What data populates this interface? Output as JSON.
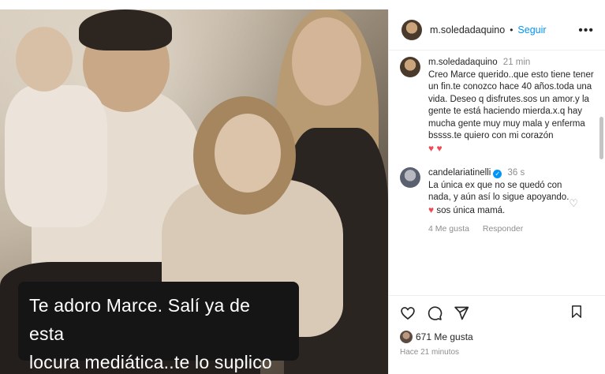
{
  "post": {
    "caption_line1": "Te adoro Marce. Salí ya de  esta",
    "caption_line2": "locura mediática..te lo suplico"
  },
  "header": {
    "username": "m.soledadaquino",
    "separator": "•",
    "follow_label": "Seguir",
    "more_icon": "more-horizontal-icon"
  },
  "comments": [
    {
      "username": "m.soledadaquino",
      "time": "21 min",
      "text": "Creo Marce querido..que esto tiene tener un fin.te conozco hace 40 años.toda una vida.  Deseo q disfrutes.sos un amor.y la gente te está haciendo mierda.x.q hay mucha gente muy muy mala y enferma bssss.te quiero con mi corazón",
      "hearts": "♥ ♥"
    },
    {
      "username": "candelariatinelli",
      "verified": "✓",
      "time": "36 s",
      "text": "La única ex que no se quedó con nada, y aún así lo sigue apoyando.",
      "heart": "♥",
      "text2": "sos única mamá.",
      "likes": "4 Me gusta",
      "reply_label": "Responder"
    }
  ],
  "actions": {
    "likes_count": "671 Me gusta",
    "posted_time": "Hace 21 minutos"
  },
  "colors": {
    "accent": "#0095f6",
    "heart": "#ed4956",
    "caption_bg": "#151515"
  }
}
